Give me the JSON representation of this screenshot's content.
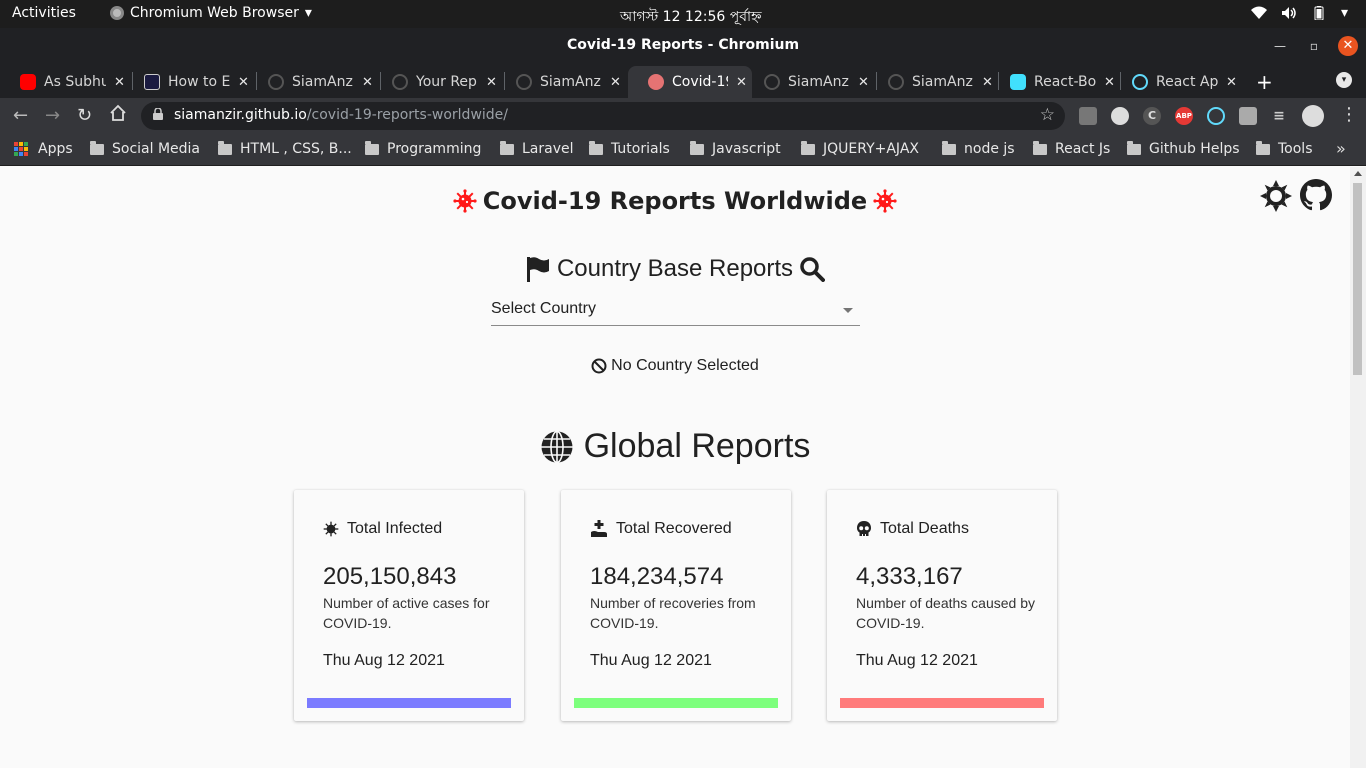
{
  "system": {
    "activities": "Activities",
    "app_name": "Chromium Web Browser",
    "clock": "আগস্ট 12  12:56 পূর্বাহ্ন"
  },
  "window": {
    "title": "Covid-19 Reports - Chromium"
  },
  "tabs": [
    {
      "label": "As Subhu",
      "favicon": "youtube-icon",
      "color": "#ff0000"
    },
    {
      "label": "How to E",
      "favicon": "angular-icon",
      "color": "#1a1a40"
    },
    {
      "label": "SiamAnz",
      "favicon": "github-icon",
      "color": "#555555"
    },
    {
      "label": "Your Rep",
      "favicon": "github-icon",
      "color": "#555555"
    },
    {
      "label": "SiamAnz",
      "favicon": "github-icon",
      "color": "#555555"
    },
    {
      "label": "Covid-19",
      "favicon": "covid-icon",
      "color": "#e57373",
      "active": true
    },
    {
      "label": "SiamAnz",
      "favicon": "github-icon",
      "color": "#555555"
    },
    {
      "label": "SiamAnz",
      "favicon": "github-icon",
      "color": "#555555"
    },
    {
      "label": "React-Bo",
      "favicon": "react-bootstrap-icon",
      "color": "#41e0fd"
    },
    {
      "label": "React Ap",
      "favicon": "react-icon",
      "color": "#61dafb"
    }
  ],
  "omnibox": {
    "host": "siamanzir.github.io",
    "path": "/covid-19-reports-worldwide/"
  },
  "extensions": [
    {
      "name": "copy-icon",
      "text": "",
      "color": "#888888"
    },
    {
      "name": "dark-reader-icon",
      "text": "",
      "color": "#dddddd"
    },
    {
      "name": "css-viewer-icon",
      "text": "C",
      "color": "#666666"
    },
    {
      "name": "adblock-plus-icon",
      "text": "ABP",
      "color": "#e53935"
    },
    {
      "name": "react-devtools-icon",
      "text": "",
      "color": "#61dafb"
    },
    {
      "name": "puzzle-icon",
      "text": "",
      "color": "#bbbbbb"
    },
    {
      "name": "reading-list-icon",
      "text": "",
      "color": "#bbbbbb"
    },
    {
      "name": "profile-icon",
      "text": "",
      "color": "#dddddd"
    }
  ],
  "bookmarks": [
    "Apps",
    "Social Media",
    "HTML , CSS, B...",
    "Programming",
    "Laravel",
    "Tutorials",
    "Javascript",
    "JQUERY+AJAX",
    "node js",
    "React Js",
    "Github Helps",
    "Tools"
  ],
  "page": {
    "title": "Covid-19 Reports Worldwide",
    "country_heading": "Country Base Reports",
    "select": {
      "value": "Select Country"
    },
    "no_country": "No Country Selected",
    "global_heading": "Global Reports",
    "cards": [
      {
        "heading": "Total Infected",
        "icon": "virus-icon",
        "value": "205,150,843",
        "description": "Number of active cases for COVID-19.",
        "date": "Thu Aug 12 2021",
        "bar_color": "#7b7bff"
      },
      {
        "heading": "Total Recovered",
        "icon": "recovered-icon",
        "value": "184,234,574",
        "description": "Number of recoveries from COVID-19.",
        "date": "Thu Aug 12 2021",
        "bar_color": "#7dff7d"
      },
      {
        "heading": "Total Deaths",
        "icon": "skull-icon",
        "value": "4,333,167",
        "description": "Number of deaths caused by COVID-19.",
        "date": "Thu Aug 12 2021",
        "bar_color": "#ff7b7b"
      }
    ]
  },
  "colors": {
    "accent_virus": "#ff1a1a",
    "dark_chrome": "#202124",
    "toolbar": "#35363a"
  }
}
